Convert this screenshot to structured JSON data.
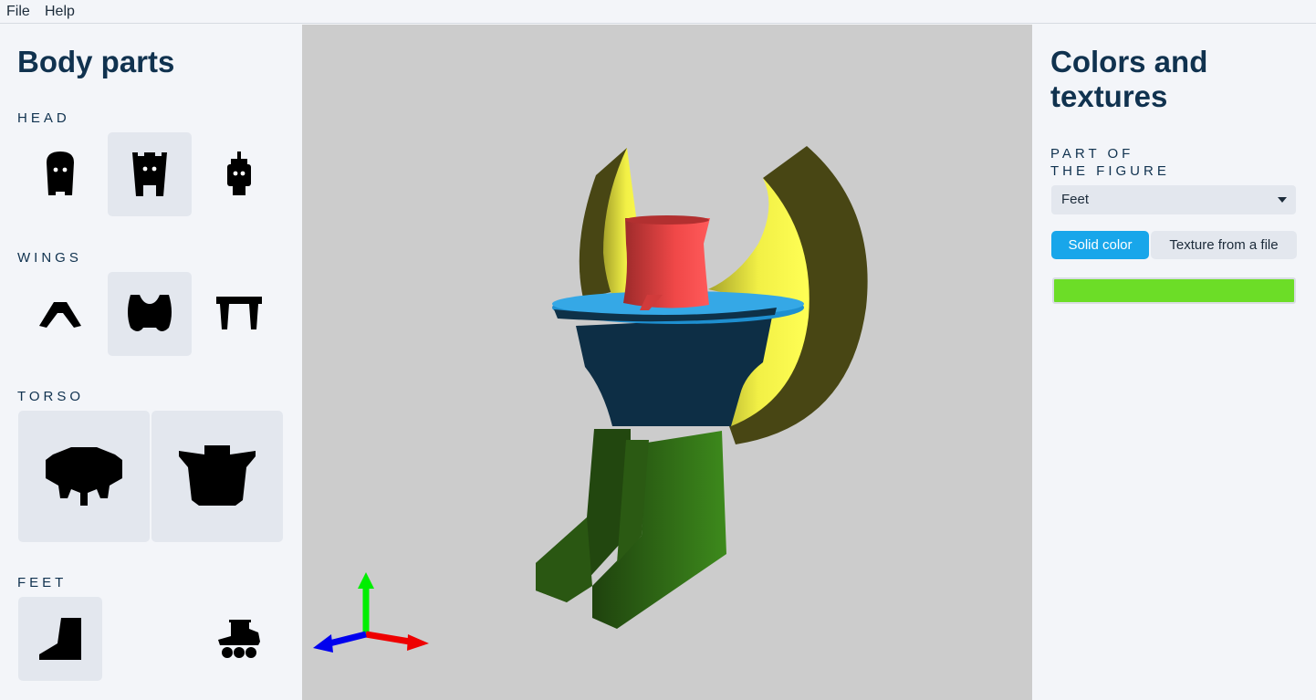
{
  "menu": {
    "file": "File",
    "help": "Help"
  },
  "left_panel": {
    "title": "Body parts",
    "sections": {
      "head": "HEAD",
      "wings": "WINGS",
      "torso": "TORSO",
      "feet": "FEET"
    }
  },
  "right_panel": {
    "title_line1": "Colors and",
    "title_line2": "textures",
    "part_label_line1": "PART OF",
    "part_label_line2": "THE FIGURE",
    "selected_part": "Feet",
    "solid_color_label": "Solid color",
    "texture_label": "Texture from a file",
    "current_color": "#6cdd27"
  },
  "colors": {
    "accent": "#18a6ea",
    "text": "#10324f",
    "selected_tile": "#e3e7ee",
    "viewport_bg": "#cccccc"
  }
}
